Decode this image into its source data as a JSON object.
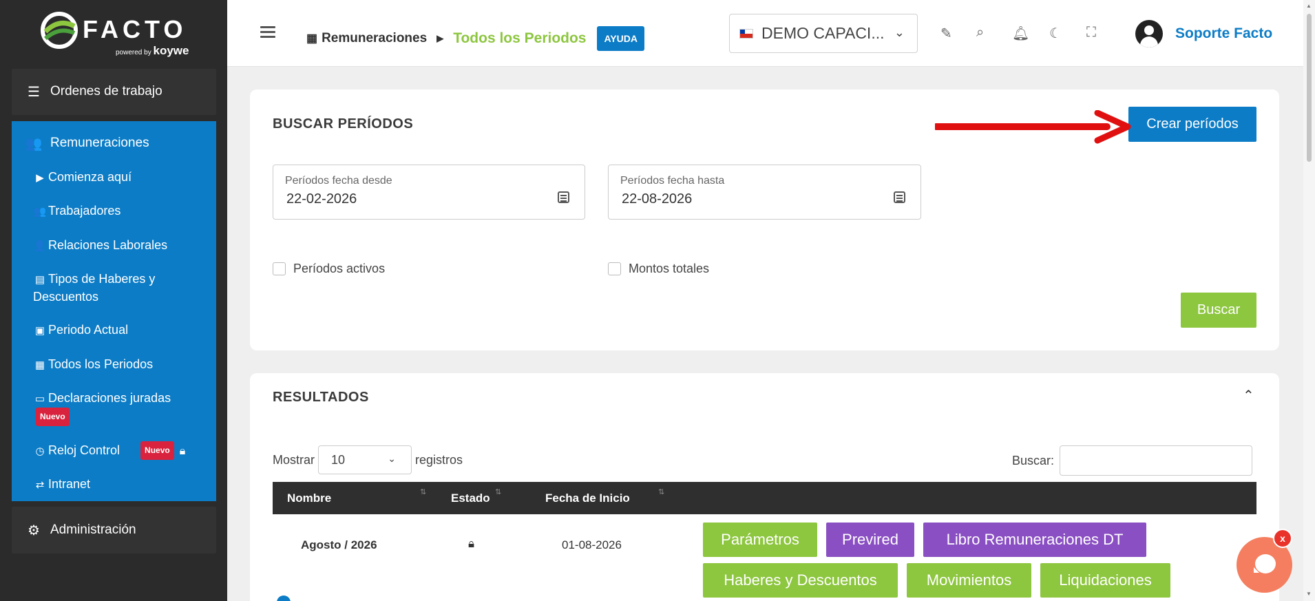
{
  "brand": {
    "name": "FACTO",
    "powered": "powered by",
    "by": "koywe"
  },
  "sidebar": {
    "ordenes": {
      "label": "Ordenes de trabajo",
      "icon": "tasks-icon"
    },
    "remuneraciones": {
      "label": "Remuneraciones",
      "icon": "users-icon",
      "items": [
        {
          "label": "Comienza aquí",
          "icon": "play-icon"
        },
        {
          "label": "Trabajadores",
          "icon": "users-icon"
        },
        {
          "label": "Relaciones Laborales",
          "icon": "user-group-icon"
        },
        {
          "label": "Tipos de Haberes y Descuentos",
          "icon": "file-icon"
        },
        {
          "label": "Periodo Actual",
          "icon": "calendar-day-icon"
        },
        {
          "label": "Todos los Periodos",
          "icon": "calendar-icon"
        },
        {
          "label": "Declaraciones juradas",
          "icon": "archive-icon",
          "badge": "Nuevo"
        },
        {
          "label": "Reloj Control",
          "icon": "clock-icon",
          "badge": "Nuevo"
        },
        {
          "label": "Intranet",
          "icon": "intranet-icon"
        }
      ]
    },
    "administracion": {
      "label": "Administración",
      "icon": "cogs-icon"
    }
  },
  "topbar": {
    "breadcrumb_root": "Remuneraciones",
    "breadcrumb_current": "Todos los Periodos",
    "help_label": "AYUDA",
    "company_name": "DEMO CAPACI...",
    "user_name": "Soporte Facto"
  },
  "search": {
    "title": "BUSCAR PERÍODOS",
    "create_label": "Crear períodos",
    "from_label": "Períodos fecha desde",
    "from_value": "22-02-2026",
    "to_label": "Períodos fecha hasta",
    "to_value": "22-08-2026",
    "active_label": "Períodos activos",
    "totals_label": "Montos totales",
    "search_button": "Buscar"
  },
  "results": {
    "title": "RESULTADOS",
    "show_label": "Mostrar",
    "page_size": "10",
    "records_label": "registros",
    "search_label": "Buscar:",
    "columns": [
      "Nombre",
      "Estado",
      "Fecha de Inicio"
    ],
    "rows": [
      {
        "name": "Agosto / 2026",
        "status_icon": "lock-icon",
        "start_date": "01-08-2026",
        "actions": [
          "Parámetros",
          "Previred",
          "Libro Remuneraciones DT",
          "Haberes y Descuentos",
          "Movimientos",
          "Liquidaciones"
        ]
      }
    ]
  },
  "chat": {
    "close_label": "x"
  },
  "colors": {
    "primary": "#0c7cc6",
    "green": "#8dc63f",
    "purple": "#8a4fc3",
    "sidebar": "#2b2b2b",
    "badge": "#d9223d",
    "chat": "#f47e5f"
  }
}
